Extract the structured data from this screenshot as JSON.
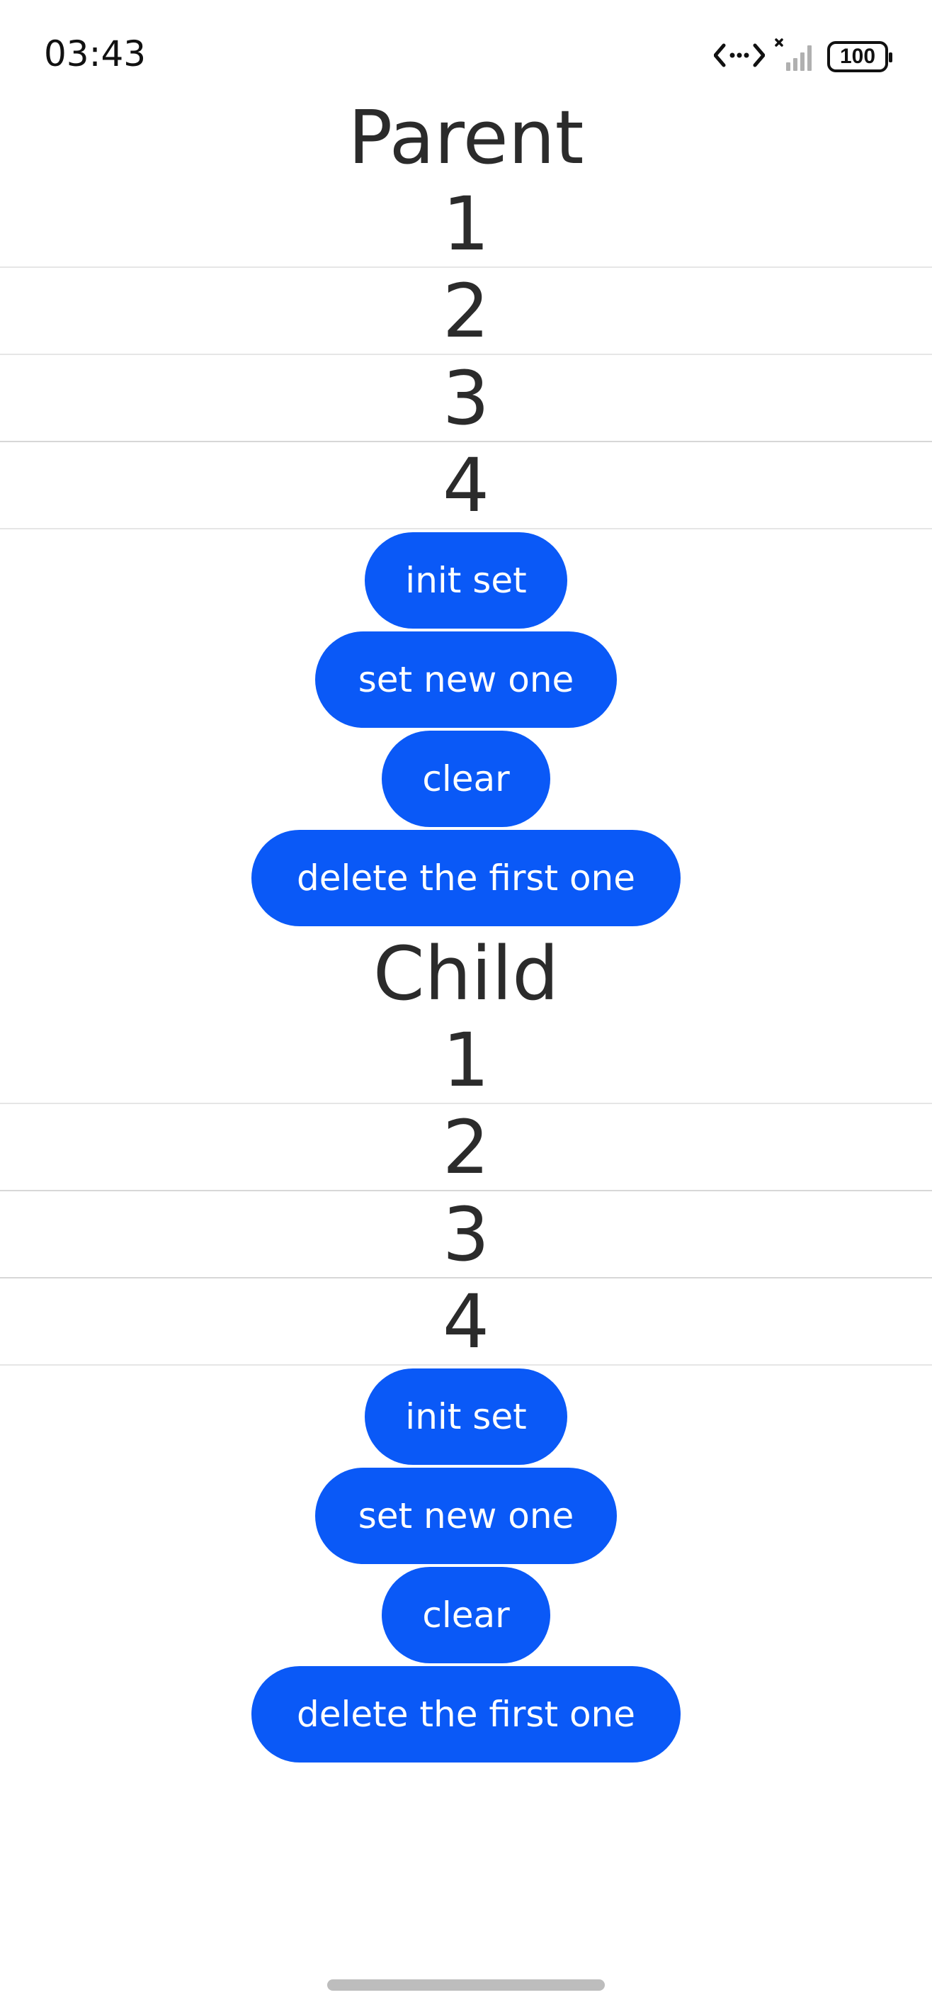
{
  "status_bar": {
    "time": "03:43",
    "battery": "100"
  },
  "parent": {
    "title": "Parent",
    "items": [
      "1",
      "2",
      "3",
      "4"
    ],
    "buttons": {
      "init": "init set",
      "set_new": "set new one",
      "clear": "clear",
      "delete_first": "delete the first one"
    }
  },
  "child": {
    "title": "Child",
    "items": [
      "1",
      "2",
      "3",
      "4"
    ],
    "buttons": {
      "init": "init set",
      "set_new": "set new one",
      "clear": "clear",
      "delete_first": "delete the first one"
    }
  },
  "colors": {
    "button_bg": "#0a59f7",
    "text": "#2b2b2b"
  }
}
